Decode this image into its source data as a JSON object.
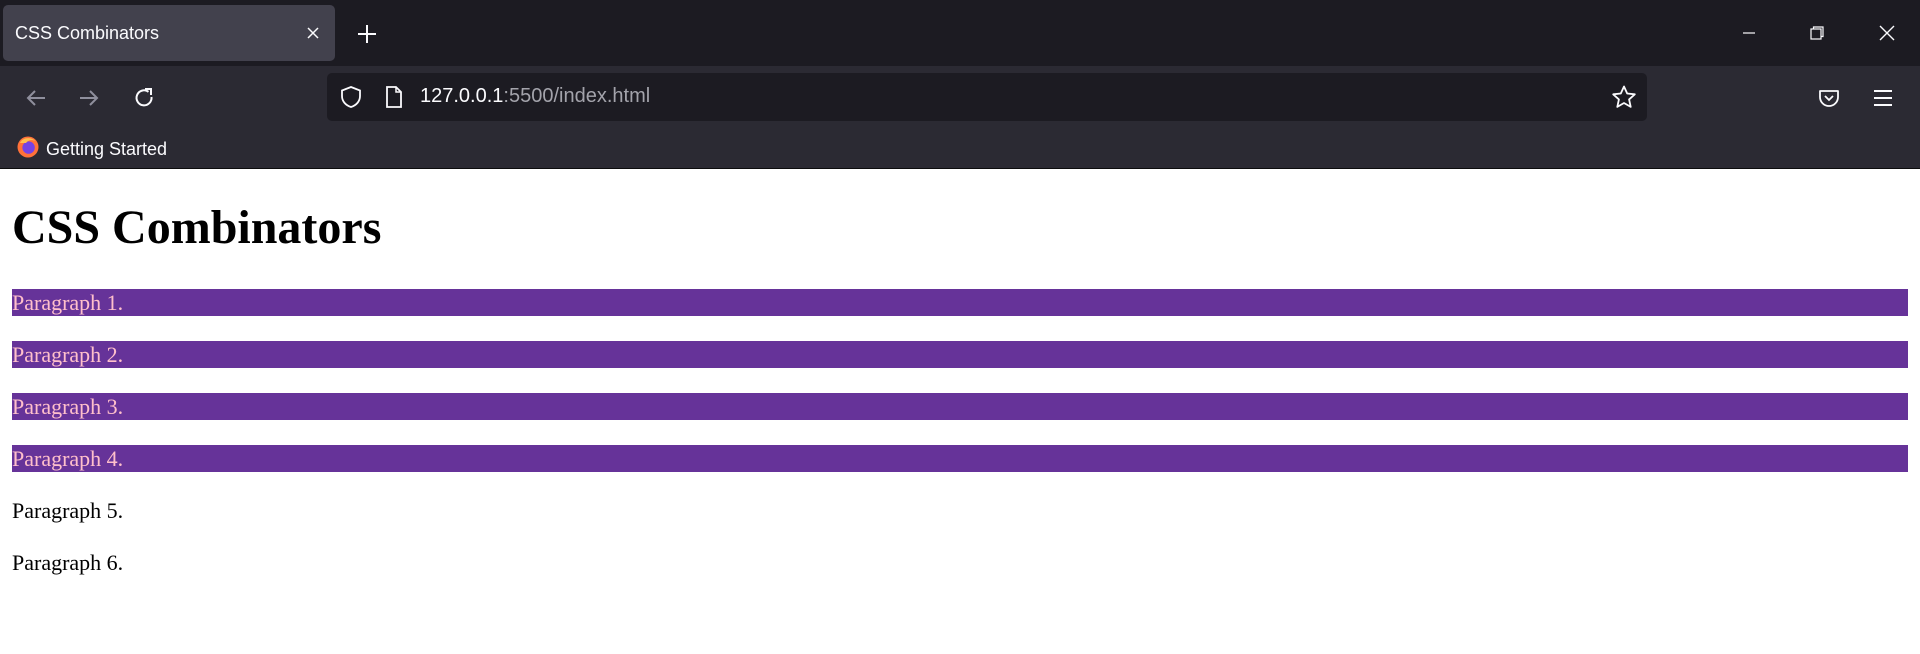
{
  "browser": {
    "tab": {
      "title": "CSS Combinators"
    },
    "url": {
      "host": "127.0.0.1",
      "rest": ":5500/index.html"
    },
    "bookmarks": [
      {
        "label": "Getting Started"
      }
    ],
    "icons": {
      "close": "close-icon",
      "new_tab": "plus-icon",
      "minimize": "minimize-icon",
      "restore": "restore-icon",
      "window_close": "window-close-icon",
      "back": "back-arrow-icon",
      "forward": "forward-arrow-icon",
      "reload": "reload-icon",
      "shield": "shield-icon",
      "page": "page-icon",
      "star": "star-icon",
      "pocket": "pocket-icon",
      "menu": "hamburger-menu-icon",
      "firefox": "firefox-icon"
    }
  },
  "page": {
    "heading": "CSS Combinators",
    "paragraphs": [
      {
        "text": "Paragraph 1.",
        "highlighted": true
      },
      {
        "text": "Paragraph 2.",
        "highlighted": true
      },
      {
        "text": "Paragraph 3.",
        "highlighted": true
      },
      {
        "text": "Paragraph 4.",
        "highlighted": true
      },
      {
        "text": "Paragraph 5.",
        "highlighted": false
      },
      {
        "text": "Paragraph 6.",
        "highlighted": false
      }
    ]
  },
  "colors": {
    "highlight_bg": "#663399",
    "highlight_text": "#ffc0cb",
    "chrome_dark": "#1c1b22",
    "chrome_mid": "#2b2a33",
    "tab_active": "#42414d"
  }
}
